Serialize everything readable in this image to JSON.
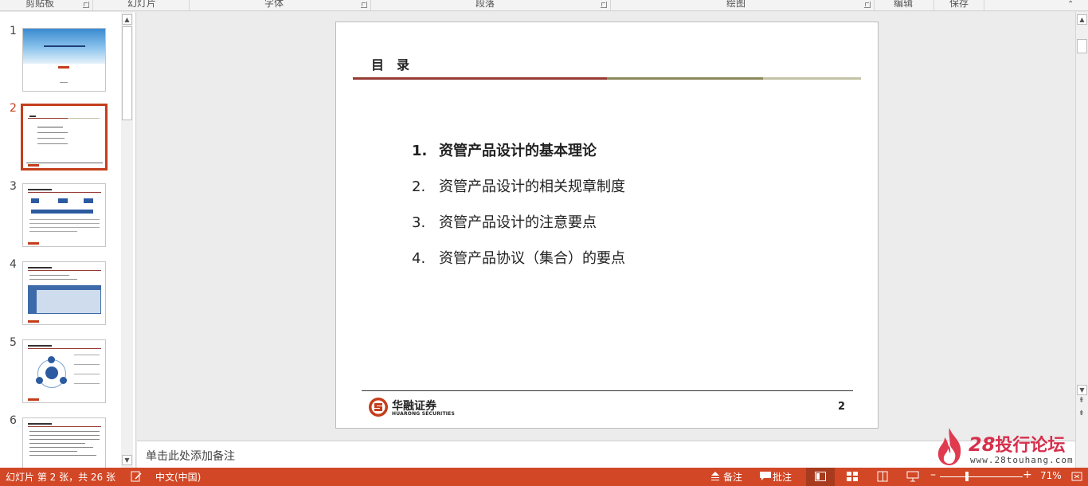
{
  "ribbon": {
    "groups": [
      "剪贴板",
      "幻灯片",
      "字体",
      "段落",
      "绘图",
      "编辑",
      "保存"
    ]
  },
  "thumbnails": [
    {
      "num": "1",
      "caption": "华融资管产品设计的基本理论"
    },
    {
      "num": "2",
      "caption": "目录"
    },
    {
      "num": "3",
      "caption": ""
    },
    {
      "num": "4",
      "caption": ""
    },
    {
      "num": "5",
      "caption": ""
    },
    {
      "num": "6",
      "caption": ""
    }
  ],
  "active_slide_index": 2,
  "slide": {
    "title": "目　录",
    "title_bar_colors": [
      "#963b34",
      "#8a8a5a",
      "#c4c2a6"
    ],
    "agenda": [
      {
        "num": "1.",
        "text": "资管产品设计的基本理论",
        "bold": true
      },
      {
        "num": "2.",
        "text": "资管产品设计的相关规章制度",
        "bold": false
      },
      {
        "num": "3.",
        "text": "资管产品设计的注意要点",
        "bold": false
      },
      {
        "num": "4.",
        "text": "资管产品协议（集合）的要点",
        "bold": false
      }
    ],
    "logo_cn": "华融证券",
    "logo_en": "HUARONG SECURITIES",
    "page_number": "2"
  },
  "notes": {
    "placeholder": "单击此处添加备注"
  },
  "status": {
    "slide_info": "幻灯片 第 2 张，共 26 张",
    "language": "中文(中国)",
    "notes_label": "备注",
    "comments_label": "批注",
    "zoom": "71%"
  },
  "watermark": {
    "number": "28",
    "title": "投行论坛",
    "url": "www.28touhang.com"
  },
  "colors": {
    "accent": "#c43e1c",
    "status_bar": "#d24726"
  }
}
